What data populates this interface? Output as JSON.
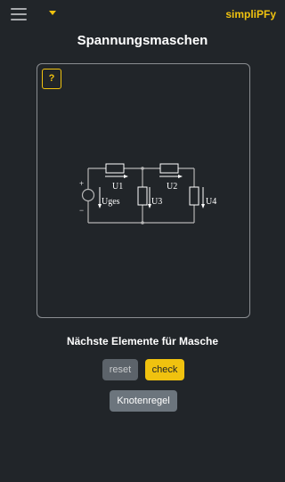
{
  "header": {
    "brand": "simpliPFy"
  },
  "page": {
    "title": "Spannungsmaschen",
    "subtitle": "Nächste Elemente für Masche"
  },
  "canvas": {
    "help_label": "?",
    "labels": {
      "u1": "U1",
      "u2": "U2",
      "u3": "U3",
      "u4": "U4",
      "uges": "Uges",
      "plus": "+",
      "minus": "−"
    }
  },
  "buttons": {
    "reset": "reset",
    "check": "check",
    "knotenregel": "Knotenregel"
  },
  "colors": {
    "background": "#212529",
    "accent": "#f0c20f",
    "wire": "#b5b5b5"
  },
  "icons": {
    "menu": "hamburger-menu-icon",
    "dropdown": "caret-down-icon"
  }
}
